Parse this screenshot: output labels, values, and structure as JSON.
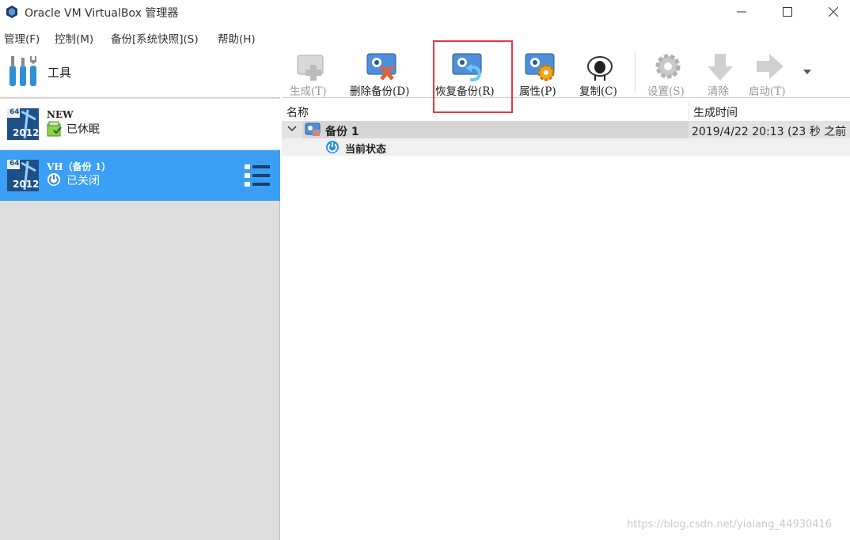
{
  "window": {
    "title": "Oracle VM VirtualBox 管理器"
  },
  "menu": {
    "items": [
      "管理(F)",
      "控制(M)",
      "备份[系统快照](S)",
      "帮助(H)"
    ]
  },
  "sidebar": {
    "tools_label": "工具",
    "vms": [
      {
        "name": "NEW",
        "state": "已休眠",
        "os_badge": "64",
        "os_year": "2012",
        "selected": false
      },
      {
        "name": "VH（备份 1）",
        "state": "已关闭",
        "os_badge": "64",
        "os_year": "2012",
        "selected": true
      }
    ]
  },
  "toolbar": {
    "create": "生成(T)",
    "delete": "删除备份(D)",
    "restore": "恢复备份(R)",
    "properties": "属性(P)",
    "clone": "复制(C)",
    "settings": "设置(S)",
    "discard": "清除",
    "start": "启动(T)"
  },
  "snapshots": {
    "columns": [
      "名称",
      "生成时间"
    ],
    "rows": [
      {
        "name": "备份 1",
        "time": "2019/4/22 20:13 (23 秒 之前"
      },
      {
        "name": "当前状态",
        "time": ""
      }
    ]
  },
  "watermark": "https://blog.csdn.net/yiaiang_44930416",
  "colors": {
    "selection": "#3ba0f5",
    "highlight_box": "#e8383d",
    "sidebar_bg": "#dedede"
  }
}
